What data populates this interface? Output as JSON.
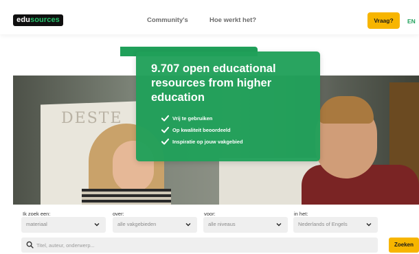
{
  "header": {
    "logo_part1": "edu",
    "logo_part2": "sources",
    "nav": [
      "Community's",
      "Hoe werkt het?"
    ],
    "ask_button": "Vraag?",
    "language": "EN"
  },
  "hero": {
    "headline": "9.707 open educational resources from higher education",
    "features": [
      "Vrij te gebruiken",
      "Op kwaliteit beoordeeld",
      "Inspiratie op jouw vakgebied"
    ],
    "board_text": "DESTE"
  },
  "search": {
    "filters": [
      {
        "label": "Ik zoek een:",
        "value": "materiaal"
      },
      {
        "label": "over:",
        "value": "alle vakgebieden"
      },
      {
        "label": "voor:",
        "value": "alle niveaus"
      },
      {
        "label": "in het:",
        "value": "Nederlands of Engels"
      }
    ],
    "placeholder": "Titel, auteur, onderwerp...",
    "submit": "Zoeken"
  },
  "colors": {
    "brand_green": "#20a05a",
    "accent_yellow": "#f7b500",
    "logo_bg": "#0f0f0f"
  }
}
